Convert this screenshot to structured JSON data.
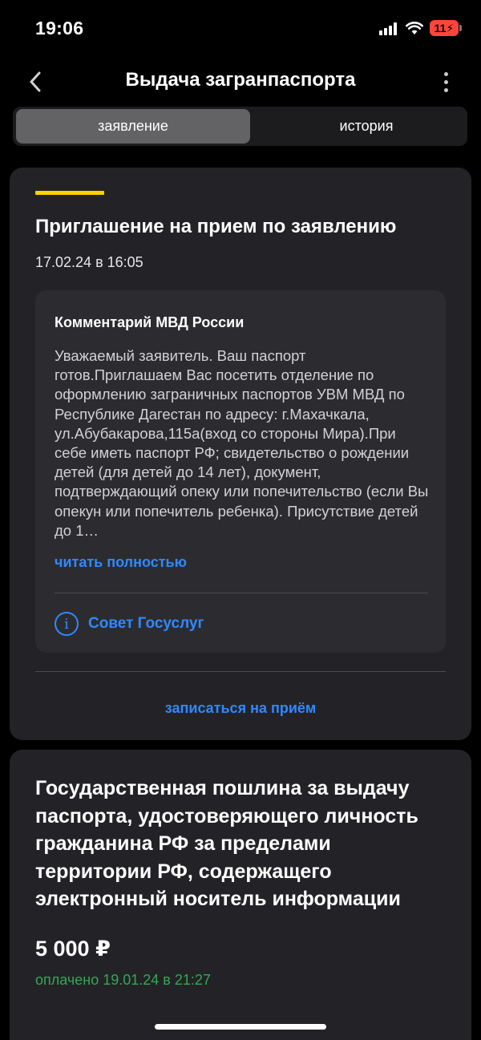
{
  "status": {
    "time": "19:06",
    "battery": "11"
  },
  "nav": {
    "title": "Выдача загранпаспорта"
  },
  "tabs": [
    {
      "label": "заявление"
    },
    {
      "label": "история"
    }
  ],
  "invitation": {
    "title": "Приглашение на прием по заявлению",
    "date": "17.02.24 в 16:05",
    "comment": {
      "title": "Комментарий МВД России",
      "text": "Уважаемый заявитель. Ваш паспорт готов.Приглашаем Вас посетить отделение по оформлению заграничных паспортов УВМ МВД по Республике Дагестан по адресу: г.Махачкала, ул.Абубакарова,115а(вход со стороны Мира).При себе иметь паспорт РФ; свидетельство о рождении детей (для детей до 14 лет), документ, подтверждающий опеку или попечительство (если Вы опекун или попечитель ребенка). Присутствие детей до 1…",
      "read_more": "читать полностью",
      "tip_label": "Совет Госуслуг"
    },
    "book_button": "записаться на приём"
  },
  "fee": {
    "title": "Государственная пошлина за выдачу паспорта, удостоверяющего личность гражданина РФ за пределами территории РФ, содержащего электронный носитель информации",
    "amount": "5 000 ₽",
    "paid": "оплачено 19.01.24 в 21:27"
  },
  "colors": {
    "accent": "#ffd200",
    "link": "#2f89ff",
    "paid": "#34a853"
  }
}
